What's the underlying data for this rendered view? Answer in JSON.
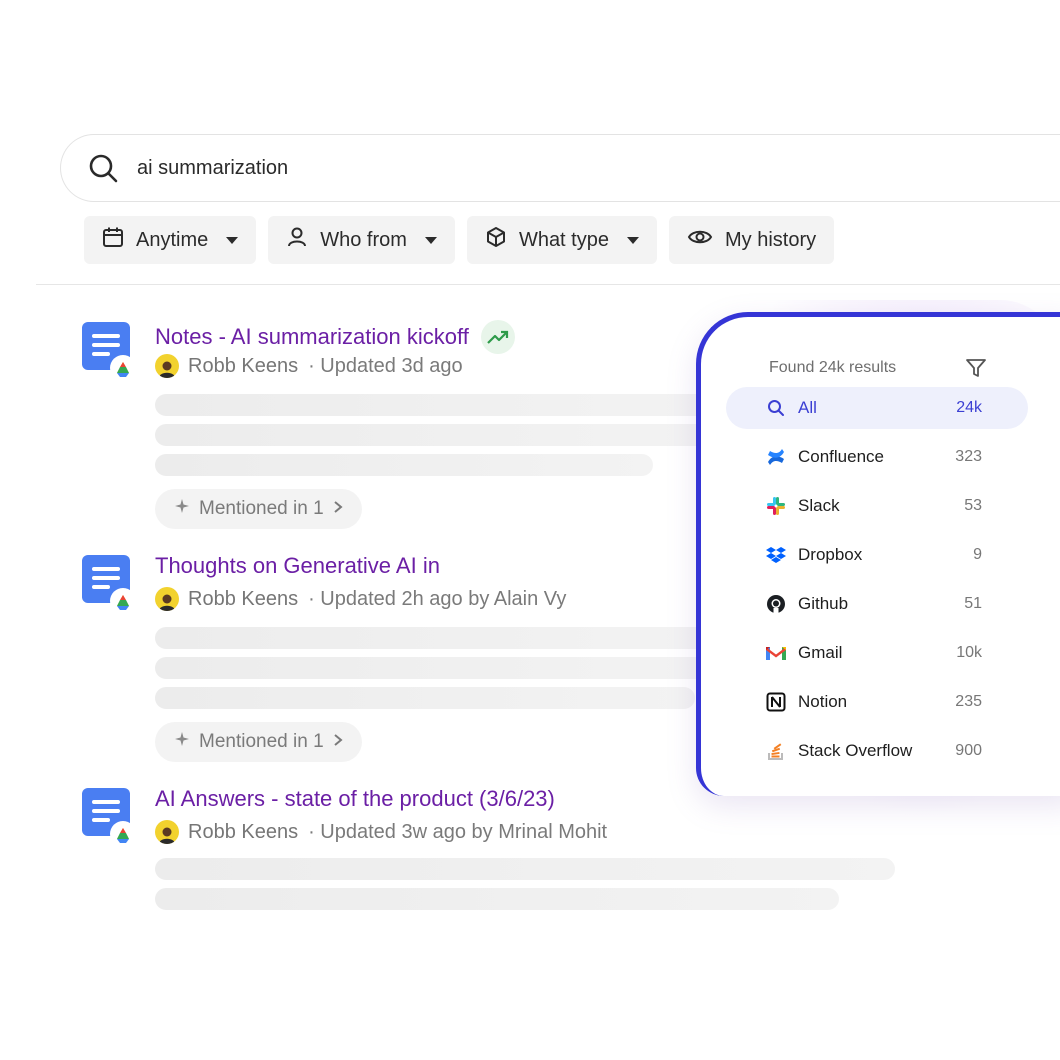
{
  "search": {
    "query": "ai summarization"
  },
  "filters": [
    {
      "label": "Anytime",
      "icon": "calendar-icon",
      "dropdown": true
    },
    {
      "label": "Who from",
      "icon": "person-icon",
      "dropdown": true
    },
    {
      "label": "What type",
      "icon": "cube-icon",
      "dropdown": true
    },
    {
      "label": "My history",
      "icon": "eye-icon",
      "dropdown": false
    }
  ],
  "results": [
    {
      "title": "Notes - AI summarization kickoff",
      "trending": true,
      "author": "Robb Keens",
      "updated": "· Updated 3d ago",
      "mention": "Mentioned in 1"
    },
    {
      "title": "Thoughts on Generative AI in",
      "trending": false,
      "author": "Robb Keens",
      "updated": "· Updated 2h ago by Alain Vy",
      "mention": "Mentioned in 1"
    },
    {
      "title": "AI Answers - state of the product (3/6/23)",
      "trending": false,
      "author": "Robb Keens",
      "updated": "· Updated 3w ago by Mrinal Mohit",
      "mention": ""
    }
  ],
  "panel": {
    "found_label": "Found 24k results",
    "sources": [
      {
        "label": "All",
        "count": "24k",
        "icon": "search-icon",
        "active": true
      },
      {
        "label": "Confluence",
        "count": "323",
        "icon": "confluence-icon",
        "active": false
      },
      {
        "label": "Slack",
        "count": "53",
        "icon": "slack-icon",
        "active": false
      },
      {
        "label": "Dropbox",
        "count": "9",
        "icon": "dropbox-icon",
        "active": false
      },
      {
        "label": "Github",
        "count": "51",
        "icon": "github-icon",
        "active": false
      },
      {
        "label": "Gmail",
        "count": "10k",
        "icon": "gmail-icon",
        "active": false
      },
      {
        "label": "Notion",
        "count": "235",
        "icon": "notion-icon",
        "active": false
      },
      {
        "label": "Stack Overflow",
        "count": "900",
        "icon": "stackoverflow-icon",
        "active": false
      }
    ]
  },
  "colors": {
    "accent": "#3535d6",
    "title": "#6b1fa5",
    "trend": "#2e9b4a"
  }
}
